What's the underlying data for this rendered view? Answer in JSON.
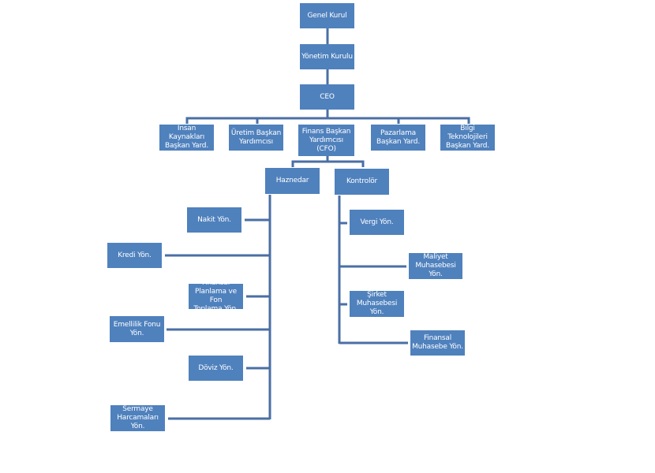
{
  "colors": {
    "box": "#4f81bd",
    "line": "#4a6fa5",
    "text": "#ffffff"
  },
  "nodes": {
    "genel_kurul": "Genel Kurul",
    "yonetim_kurulu": "Yönetim Kurulu",
    "ceo": "CEO",
    "insan_kaynaklari": "İnsan Kaynakları\nBaşkan Yard.",
    "uretim": "Üretim Başkan\nYardımcısı",
    "finans_cfo": "Finans Başkan\nYardımcısı\n(CFO)",
    "pazarlama": "Pazarlama\nBaşkan Yard.",
    "bilgi_teknolojileri": "Bilgi\nTeknolojileri\nBaşkan Yard.",
    "haznedar": "Haznedar",
    "kontrolor": "Kontrolör",
    "nakit": "Nakit Yön.",
    "kredi": "Kredi Yön.",
    "finansal_planlama": "Finansal\nPlanlama ve Fon\nToplama Yön.",
    "emeklilik": "Emellilik Fonu\nYön.",
    "doviz": "Döviz Yön.",
    "sermaye": "Sermaye\nHarcamaları\nYön.",
    "vergi": "Vergi Yön.",
    "maliyet": "Maliyet\nMuhasebesi\nYön.",
    "sirket": "Şirket\nMuhasebesi\nYön.",
    "finansal_muhasebe": "Finansal\nMuhasebe Yön."
  }
}
